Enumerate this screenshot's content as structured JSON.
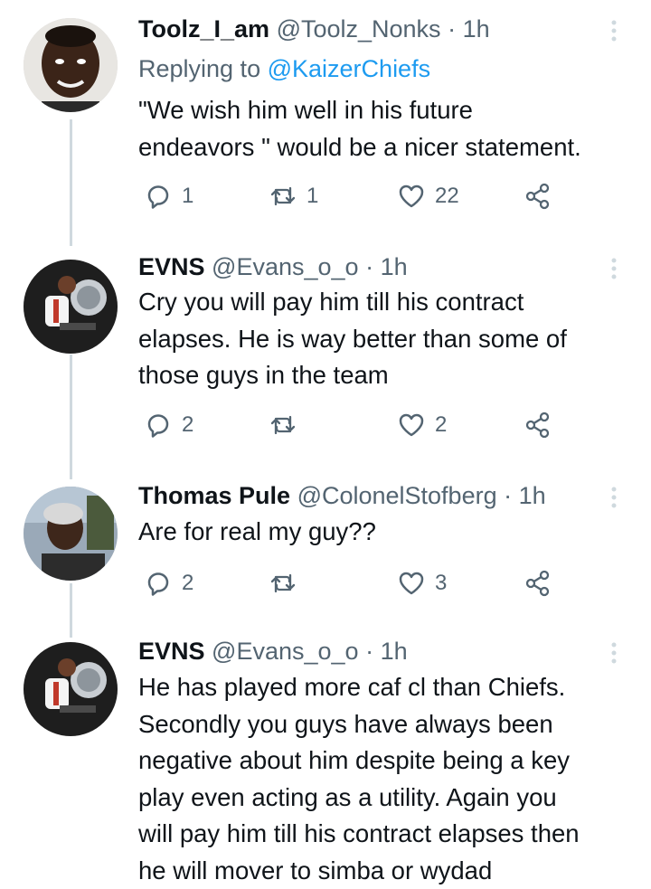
{
  "tweets": [
    {
      "name": "Toolz_I_am",
      "handle": "@Toolz_Nonks",
      "time": "1h",
      "replying_label": "Replying to",
      "replying_to": "@KaizerChiefs",
      "lines": [
        "\"We wish him well in his future",
        "endeavors \" would be a nicer statement."
      ],
      "replies": "1",
      "retweets": "1",
      "likes": "22"
    },
    {
      "name": "EVNS",
      "handle": "@Evans_o_o",
      "time": "1h",
      "lines": [
        "Cry you will pay him till his contract",
        "elapses. He is way better than some of",
        "those guys in the team"
      ],
      "replies": "2",
      "retweets": "",
      "likes": "2"
    },
    {
      "name": "Thomas Pule",
      "handle": "@ColonelStofberg",
      "time": "1h",
      "lines": [
        "Are for real my guy??"
      ],
      "replies": "2",
      "retweets": "",
      "likes": "3"
    },
    {
      "name": "EVNS",
      "handle": "@Evans_o_o",
      "time": "1h",
      "lines": [
        "He has played more caf cl than Chiefs.",
        "Secondly you guys have always been",
        "negative about him despite being a key",
        "play even acting as a utility. Again you",
        "will pay him till his contract elapses then",
        "he will mover to simba or wydad"
      ]
    }
  ],
  "separator": "·",
  "colors": {
    "link": "#1d9bf0",
    "muted": "#536471",
    "thread_line": "#cfd9de"
  },
  "icons": [
    "more-icon",
    "reply-icon",
    "retweet-icon",
    "like-icon",
    "share-icon"
  ]
}
